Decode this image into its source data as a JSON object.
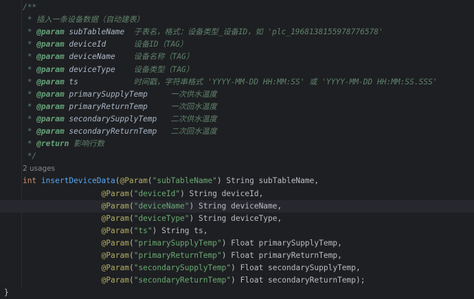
{
  "editor": {
    "current_line_index": 16,
    "lines": [
      {
        "indent": 4,
        "kind": "doc_open",
        "parts": [
          [
            "c-doc",
            "/**"
          ]
        ]
      },
      {
        "indent": 5,
        "kind": "doc",
        "parts": [
          [
            "c-doc",
            "* 插入一条设备数据（自动建表）"
          ]
        ]
      },
      {
        "indent": 5,
        "kind": "doc",
        "parts": [
          [
            "c-doc",
            "* "
          ],
          [
            "c-tag",
            "@param"
          ],
          [
            "c-pname",
            " subTableName  "
          ],
          [
            "c-doc",
            "子表名，格式：设备类型_设备ID，如 'plc_1968138155978776578'"
          ]
        ]
      },
      {
        "indent": 5,
        "kind": "doc",
        "parts": [
          [
            "c-doc",
            "* "
          ],
          [
            "c-tag",
            "@param"
          ],
          [
            "c-pname",
            " deviceId      "
          ],
          [
            "c-doc",
            "设备ID（TAG）"
          ]
        ]
      },
      {
        "indent": 5,
        "kind": "doc",
        "parts": [
          [
            "c-doc",
            "* "
          ],
          [
            "c-tag",
            "@param"
          ],
          [
            "c-pname",
            " deviceName    "
          ],
          [
            "c-doc",
            "设备名称（TAG）"
          ]
        ]
      },
      {
        "indent": 5,
        "kind": "doc",
        "parts": [
          [
            "c-doc",
            "* "
          ],
          [
            "c-tag",
            "@param"
          ],
          [
            "c-pname",
            " deviceType    "
          ],
          [
            "c-doc",
            "设备类型（TAG）"
          ]
        ]
      },
      {
        "indent": 5,
        "kind": "doc",
        "parts": [
          [
            "c-doc",
            "* "
          ],
          [
            "c-tag",
            "@param"
          ],
          [
            "c-pname",
            " ts            "
          ],
          [
            "c-doc",
            "时间戳，字符串格式 'YYYY-MM-DD HH:MM:SS' 或 'YYYY-MM-DD HH:MM:SS.SSS'"
          ]
        ]
      },
      {
        "indent": 5,
        "kind": "doc",
        "parts": [
          [
            "c-doc",
            "* "
          ],
          [
            "c-tag",
            "@param"
          ],
          [
            "c-pname",
            " primarySupplyTemp     "
          ],
          [
            "c-doc",
            "一次供水温度"
          ]
        ]
      },
      {
        "indent": 5,
        "kind": "doc",
        "parts": [
          [
            "c-doc",
            "* "
          ],
          [
            "c-tag",
            "@param"
          ],
          [
            "c-pname",
            " primaryReturnTemp     "
          ],
          [
            "c-doc",
            "一次回水温度"
          ]
        ]
      },
      {
        "indent": 5,
        "kind": "doc",
        "parts": [
          [
            "c-doc",
            "* "
          ],
          [
            "c-tag",
            "@param"
          ],
          [
            "c-pname",
            " secondarySupplyTemp   "
          ],
          [
            "c-doc",
            "二次供水温度"
          ]
        ]
      },
      {
        "indent": 5,
        "kind": "doc",
        "parts": [
          [
            "c-doc",
            "* "
          ],
          [
            "c-tag",
            "@param"
          ],
          [
            "c-pname",
            " secondaryReturnTemp   "
          ],
          [
            "c-doc",
            "二次回水温度"
          ]
        ]
      },
      {
        "indent": 5,
        "kind": "doc",
        "parts": [
          [
            "c-doc",
            "* "
          ],
          [
            "c-tag",
            "@return"
          ],
          [
            "c-doc",
            " 影响行数"
          ]
        ]
      },
      {
        "indent": 5,
        "kind": "doc_close",
        "parts": [
          [
            "c-doc",
            "*/"
          ]
        ]
      },
      {
        "indent": 4,
        "kind": "usages",
        "parts": [
          [
            "usages",
            "2 usages"
          ]
        ]
      },
      {
        "indent": 4,
        "kind": "code",
        "parts": [
          [
            "kw",
            "int"
          ],
          [
            "plain",
            " "
          ],
          [
            "fn",
            "insertDeviceData"
          ],
          [
            "plain",
            "("
          ],
          [
            "ann",
            "@Param"
          ],
          [
            "plain",
            "("
          ],
          [
            "c-str",
            "\"subTableName\""
          ],
          [
            "plain",
            ") String subTableName,"
          ]
        ]
      },
      {
        "indent": 21,
        "kind": "code",
        "parts": [
          [
            "ann",
            "@Param"
          ],
          [
            "plain",
            "("
          ],
          [
            "c-str",
            "\"deviceId\""
          ],
          [
            "plain",
            ") String deviceId,"
          ]
        ]
      },
      {
        "indent": 21,
        "kind": "code",
        "parts": [
          [
            "ann",
            "@Param"
          ],
          [
            "plain",
            "("
          ],
          [
            "c-str",
            "\"deviceName\""
          ],
          [
            "plain",
            ") String deviceName,"
          ]
        ]
      },
      {
        "indent": 21,
        "kind": "code",
        "parts": [
          [
            "ann",
            "@Param"
          ],
          [
            "plain",
            "("
          ],
          [
            "c-str",
            "\"deviceType\""
          ],
          [
            "plain",
            ") String deviceType,"
          ]
        ]
      },
      {
        "indent": 21,
        "kind": "code",
        "parts": [
          [
            "ann",
            "@Param"
          ],
          [
            "plain",
            "("
          ],
          [
            "c-str",
            "\"ts\""
          ],
          [
            "plain",
            ") String ts,"
          ]
        ]
      },
      {
        "indent": 21,
        "kind": "code",
        "parts": [
          [
            "ann",
            "@Param"
          ],
          [
            "plain",
            "("
          ],
          [
            "c-str",
            "\"primarySupplyTemp\""
          ],
          [
            "plain",
            ") Float primarySupplyTemp,"
          ]
        ]
      },
      {
        "indent": 21,
        "kind": "code",
        "parts": [
          [
            "ann",
            "@Param"
          ],
          [
            "plain",
            "("
          ],
          [
            "c-str",
            "\"primaryReturnTemp\""
          ],
          [
            "plain",
            ") Float primaryReturnTemp,"
          ]
        ]
      },
      {
        "indent": 21,
        "kind": "code",
        "parts": [
          [
            "ann",
            "@Param"
          ],
          [
            "plain",
            "("
          ],
          [
            "c-str",
            "\"secondarySupplyTemp\""
          ],
          [
            "plain",
            ") Float secondarySupplyTemp,"
          ]
        ]
      },
      {
        "indent": 21,
        "kind": "code",
        "parts": [
          [
            "ann",
            "@Param"
          ],
          [
            "plain",
            "("
          ],
          [
            "c-str",
            "\"secondaryReturnTemp\""
          ],
          [
            "plain",
            ") Float secondaryReturnTemp);"
          ]
        ]
      },
      {
        "indent": 0,
        "kind": "code",
        "parts": [
          [
            "plain",
            "}"
          ]
        ]
      }
    ]
  }
}
